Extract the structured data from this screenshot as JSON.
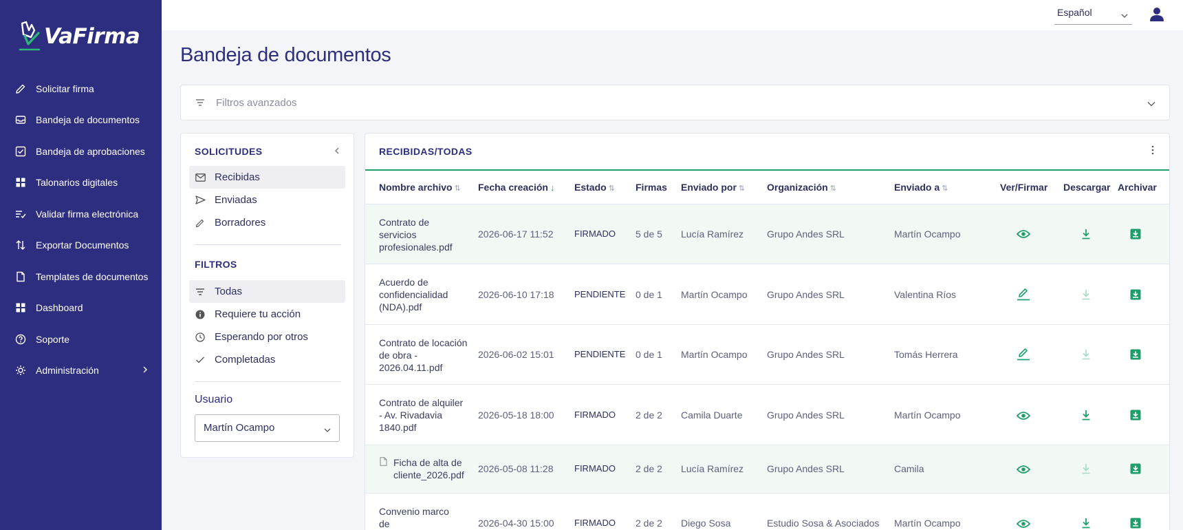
{
  "brand": {
    "name": "VaFirma"
  },
  "sidebar": {
    "items": [
      {
        "label": "Solicitar firma",
        "icon": "pencil-icon"
      },
      {
        "label": "Bandeja de documentos",
        "icon": "inbox-icon"
      },
      {
        "label": "Bandeja de aprobaciones",
        "icon": "checkbox-icon"
      },
      {
        "label": "Talonarios digitales",
        "icon": "grid-icon"
      },
      {
        "label": "Validar firma electrónica",
        "icon": "list-check-icon"
      },
      {
        "label": "Exportar Documentos",
        "icon": "swap-vertical-icon"
      },
      {
        "label": "Templates de documentos",
        "icon": "file-icon"
      },
      {
        "label": "Dashboard",
        "icon": "grid-icon"
      },
      {
        "label": "Soporte",
        "icon": "help-circle-icon"
      },
      {
        "label": "Administración",
        "icon": "settings-icon"
      }
    ]
  },
  "topbar": {
    "language": "Español"
  },
  "page": {
    "title": "Bandeja de documentos"
  },
  "filters_bar": {
    "placeholder": "Filtros avanzados"
  },
  "left_panel": {
    "solicitudes_title": "SOLICITUDES",
    "solicitudes": [
      {
        "label": "Recibidas",
        "icon": "mail-icon"
      },
      {
        "label": "Enviadas",
        "icon": "send-icon"
      },
      {
        "label": "Borradores",
        "icon": "pencil-icon"
      }
    ],
    "filtros_title": "FILTROS",
    "filtros": [
      {
        "label": "Todas",
        "icon": "filter-lines-icon"
      },
      {
        "label": "Requiere tu acción",
        "icon": "info-filled-icon"
      },
      {
        "label": "Esperando por otros",
        "icon": "clock-icon"
      },
      {
        "label": "Completadas",
        "icon": "check-icon"
      }
    ],
    "usuario_label": "Usuario",
    "usuario_value": "Martín Ocampo"
  },
  "table": {
    "title": "RECIBIDAS/TODAS",
    "columns": [
      "Nombre archivo",
      "Fecha creación",
      "Estado",
      "Firmas",
      "Enviado por",
      "Organización",
      "Enviado a",
      "Ver/Firmar",
      "Descargar",
      "Archivar"
    ],
    "rows": [
      {
        "name": "Contrato de servicios profesionales.pdf",
        "fecha": "2026-06-17 11:52",
        "estado": "FIRMADO",
        "firmas": "5 de 5",
        "enviado_por": "Lucía Ramírez",
        "organizacion": "Grupo Andes SRL",
        "enviado_a": "Martín Ocampo",
        "action": "eye-icon",
        "download_enabled": true
      },
      {
        "name": "Acuerdo de confidencialidad (NDA).pdf",
        "fecha": "2026-06-10 17:18",
        "estado": "PENDIENTE",
        "firmas": "0 de 1",
        "enviado_por": "Martín Ocampo",
        "organizacion": "Grupo Andes SRL",
        "enviado_a": "Valentina Ríos",
        "action": "sign-icon",
        "download_enabled": false
      },
      {
        "name": "Contrato de locación de obra - 2026.04.11.pdf",
        "fecha": "2026-06-02 15:01",
        "estado": "PENDIENTE",
        "firmas": "0 de 1",
        "enviado_por": "Martín Ocampo",
        "organizacion": "Grupo Andes SRL",
        "enviado_a": "Tomás Herrera",
        "action": "sign-icon",
        "download_enabled": false
      },
      {
        "name": "Contrato de alquiler - Av. Rivadavia 1840.pdf",
        "fecha": "2026-05-18 18:00",
        "estado": "FIRMADO",
        "firmas": "2 de 2",
        "enviado_por": "Camila Duarte",
        "organizacion": "Grupo Andes SRL",
        "enviado_a": "Martín Ocampo",
        "action": "eye-icon",
        "download_enabled": true
      },
      {
        "name": "Ficha de alta de cliente_2026.pdf",
        "fecha": "2026-05-08 11:28",
        "estado": "FIRMADO",
        "firmas": "2 de 2",
        "enviado_por": "Lucía Ramírez",
        "organizacion": "Grupo Andes SRL",
        "enviado_a": "Camila",
        "action": "eye-icon",
        "download_enabled": false
      },
      {
        "name": "Convenio marco de",
        "fecha": "2026-04-30 15:00",
        "estado": "FIRMADO",
        "firmas": "2 de 2",
        "enviado_por": "Diego Sosa",
        "organizacion": "Estudio Sosa & Asociados",
        "enviado_a": "Martín Ocampo",
        "action": "eye-icon",
        "download_enabled": true
      }
    ]
  },
  "colors": {
    "sidebar": "#2d2e7f",
    "accent": "#1f9d6b",
    "title": "#2d2e7f"
  }
}
